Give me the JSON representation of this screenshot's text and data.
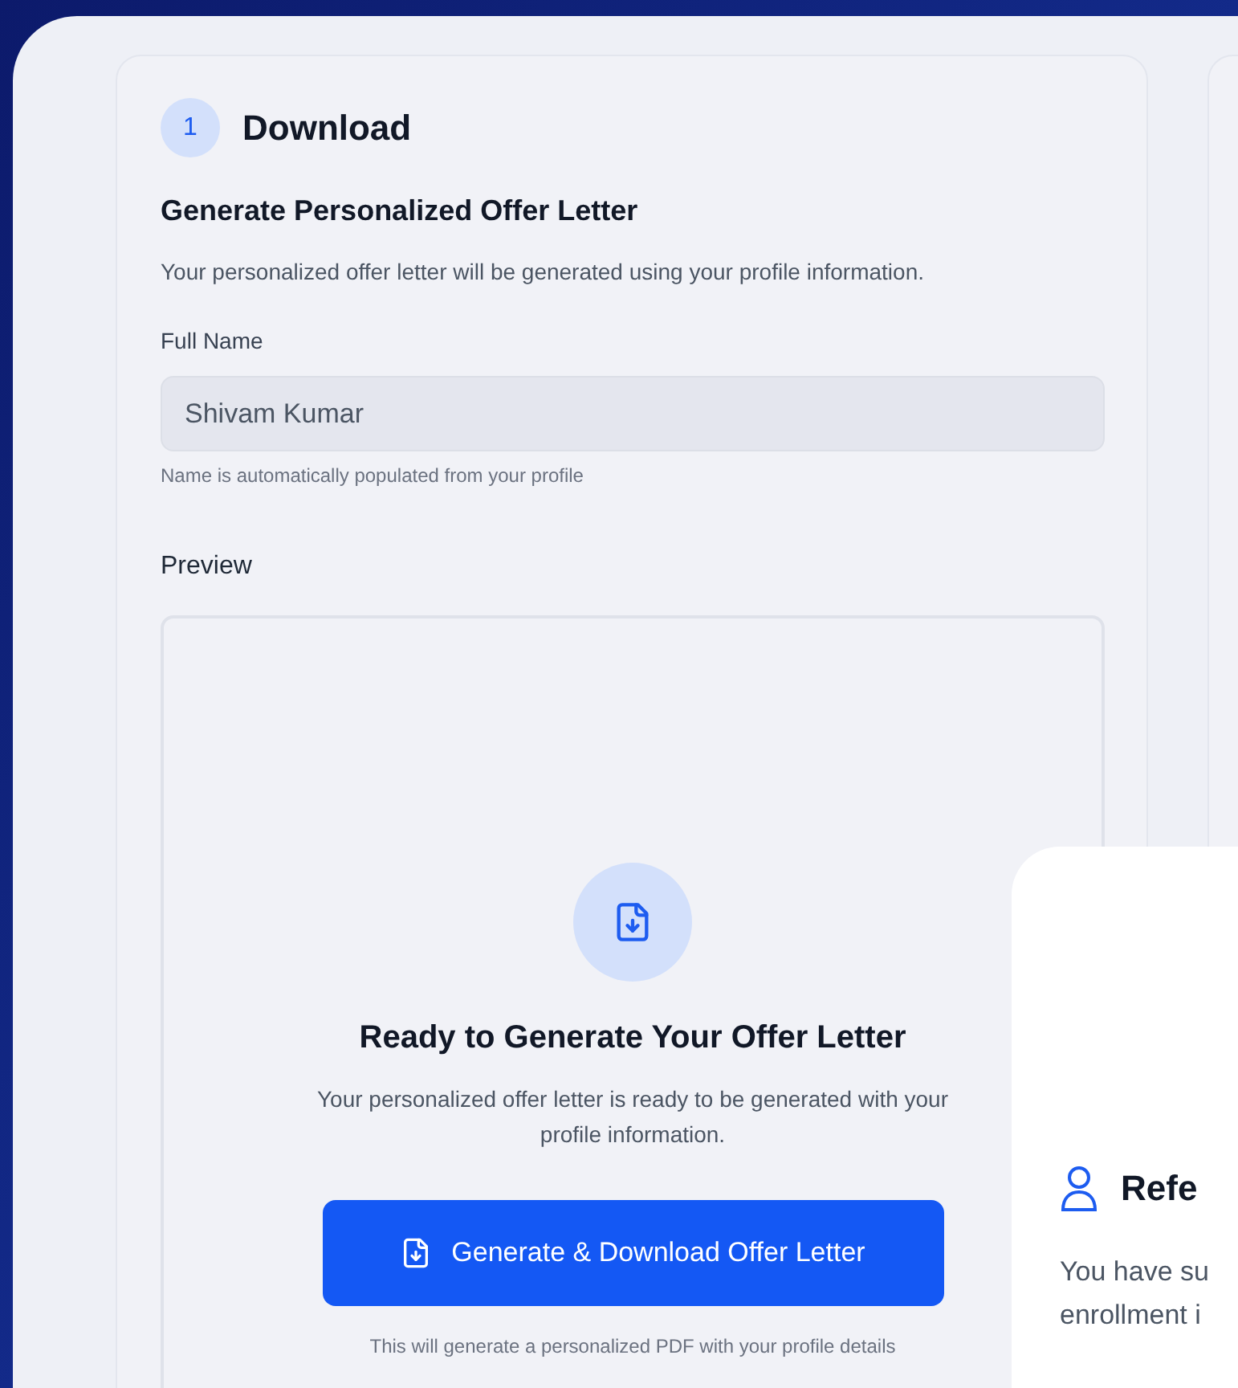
{
  "step": {
    "number": "1",
    "title": "Download"
  },
  "section": {
    "heading": "Generate Personalized Offer Letter",
    "description": "Your personalized offer letter will be generated using your profile information."
  },
  "full_name": {
    "label": "Full Name",
    "value": "Shivam Kumar",
    "hint": "Name is automatically populated from your profile"
  },
  "preview": {
    "label": "Preview",
    "title": "Ready to Generate Your Offer Letter",
    "text": "Your personalized offer letter is ready to be generated with your profile information.",
    "button": "Generate & Download Offer Letter",
    "note": "This will generate a personalized PDF with your profile details"
  },
  "overlay_card": {
    "title": "Refe",
    "lines": [
      "You have su",
      "enrollment i"
    ]
  }
}
